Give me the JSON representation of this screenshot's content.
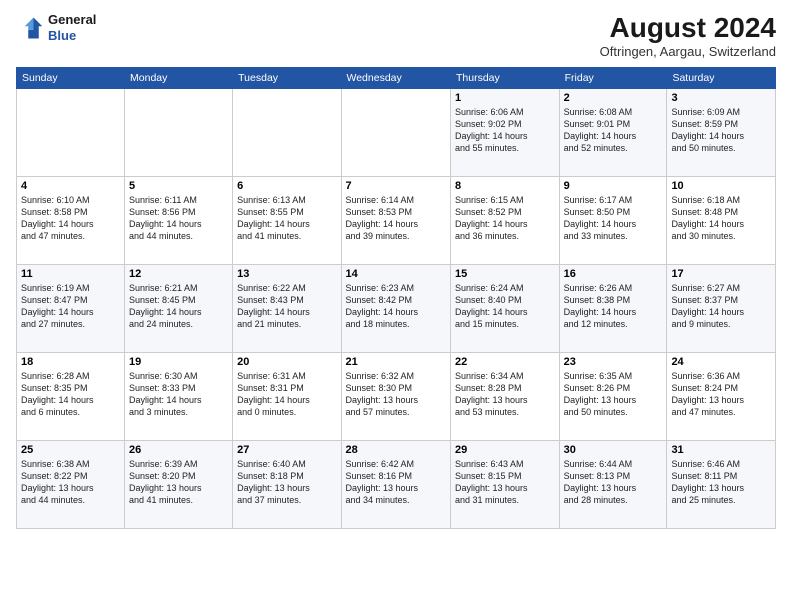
{
  "header": {
    "logo_line1": "General",
    "logo_line2": "Blue",
    "month_year": "August 2024",
    "location": "Oftringen, Aargau, Switzerland"
  },
  "weekdays": [
    "Sunday",
    "Monday",
    "Tuesday",
    "Wednesday",
    "Thursday",
    "Friday",
    "Saturday"
  ],
  "weeks": [
    [
      {
        "num": "",
        "info": ""
      },
      {
        "num": "",
        "info": ""
      },
      {
        "num": "",
        "info": ""
      },
      {
        "num": "",
        "info": ""
      },
      {
        "num": "1",
        "info": "Sunrise: 6:06 AM\nSunset: 9:02 PM\nDaylight: 14 hours\nand 55 minutes."
      },
      {
        "num": "2",
        "info": "Sunrise: 6:08 AM\nSunset: 9:01 PM\nDaylight: 14 hours\nand 52 minutes."
      },
      {
        "num": "3",
        "info": "Sunrise: 6:09 AM\nSunset: 8:59 PM\nDaylight: 14 hours\nand 50 minutes."
      }
    ],
    [
      {
        "num": "4",
        "info": "Sunrise: 6:10 AM\nSunset: 8:58 PM\nDaylight: 14 hours\nand 47 minutes."
      },
      {
        "num": "5",
        "info": "Sunrise: 6:11 AM\nSunset: 8:56 PM\nDaylight: 14 hours\nand 44 minutes."
      },
      {
        "num": "6",
        "info": "Sunrise: 6:13 AM\nSunset: 8:55 PM\nDaylight: 14 hours\nand 41 minutes."
      },
      {
        "num": "7",
        "info": "Sunrise: 6:14 AM\nSunset: 8:53 PM\nDaylight: 14 hours\nand 39 minutes."
      },
      {
        "num": "8",
        "info": "Sunrise: 6:15 AM\nSunset: 8:52 PM\nDaylight: 14 hours\nand 36 minutes."
      },
      {
        "num": "9",
        "info": "Sunrise: 6:17 AM\nSunset: 8:50 PM\nDaylight: 14 hours\nand 33 minutes."
      },
      {
        "num": "10",
        "info": "Sunrise: 6:18 AM\nSunset: 8:48 PM\nDaylight: 14 hours\nand 30 minutes."
      }
    ],
    [
      {
        "num": "11",
        "info": "Sunrise: 6:19 AM\nSunset: 8:47 PM\nDaylight: 14 hours\nand 27 minutes."
      },
      {
        "num": "12",
        "info": "Sunrise: 6:21 AM\nSunset: 8:45 PM\nDaylight: 14 hours\nand 24 minutes."
      },
      {
        "num": "13",
        "info": "Sunrise: 6:22 AM\nSunset: 8:43 PM\nDaylight: 14 hours\nand 21 minutes."
      },
      {
        "num": "14",
        "info": "Sunrise: 6:23 AM\nSunset: 8:42 PM\nDaylight: 14 hours\nand 18 minutes."
      },
      {
        "num": "15",
        "info": "Sunrise: 6:24 AM\nSunset: 8:40 PM\nDaylight: 14 hours\nand 15 minutes."
      },
      {
        "num": "16",
        "info": "Sunrise: 6:26 AM\nSunset: 8:38 PM\nDaylight: 14 hours\nand 12 minutes."
      },
      {
        "num": "17",
        "info": "Sunrise: 6:27 AM\nSunset: 8:37 PM\nDaylight: 14 hours\nand 9 minutes."
      }
    ],
    [
      {
        "num": "18",
        "info": "Sunrise: 6:28 AM\nSunset: 8:35 PM\nDaylight: 14 hours\nand 6 minutes."
      },
      {
        "num": "19",
        "info": "Sunrise: 6:30 AM\nSunset: 8:33 PM\nDaylight: 14 hours\nand 3 minutes."
      },
      {
        "num": "20",
        "info": "Sunrise: 6:31 AM\nSunset: 8:31 PM\nDaylight: 14 hours\nand 0 minutes."
      },
      {
        "num": "21",
        "info": "Sunrise: 6:32 AM\nSunset: 8:30 PM\nDaylight: 13 hours\nand 57 minutes."
      },
      {
        "num": "22",
        "info": "Sunrise: 6:34 AM\nSunset: 8:28 PM\nDaylight: 13 hours\nand 53 minutes."
      },
      {
        "num": "23",
        "info": "Sunrise: 6:35 AM\nSunset: 8:26 PM\nDaylight: 13 hours\nand 50 minutes."
      },
      {
        "num": "24",
        "info": "Sunrise: 6:36 AM\nSunset: 8:24 PM\nDaylight: 13 hours\nand 47 minutes."
      }
    ],
    [
      {
        "num": "25",
        "info": "Sunrise: 6:38 AM\nSunset: 8:22 PM\nDaylight: 13 hours\nand 44 minutes."
      },
      {
        "num": "26",
        "info": "Sunrise: 6:39 AM\nSunset: 8:20 PM\nDaylight: 13 hours\nand 41 minutes."
      },
      {
        "num": "27",
        "info": "Sunrise: 6:40 AM\nSunset: 8:18 PM\nDaylight: 13 hours\nand 37 minutes."
      },
      {
        "num": "28",
        "info": "Sunrise: 6:42 AM\nSunset: 8:16 PM\nDaylight: 13 hours\nand 34 minutes."
      },
      {
        "num": "29",
        "info": "Sunrise: 6:43 AM\nSunset: 8:15 PM\nDaylight: 13 hours\nand 31 minutes."
      },
      {
        "num": "30",
        "info": "Sunrise: 6:44 AM\nSunset: 8:13 PM\nDaylight: 13 hours\nand 28 minutes."
      },
      {
        "num": "31",
        "info": "Sunrise: 6:46 AM\nSunset: 8:11 PM\nDaylight: 13 hours\nand 25 minutes."
      }
    ]
  ]
}
